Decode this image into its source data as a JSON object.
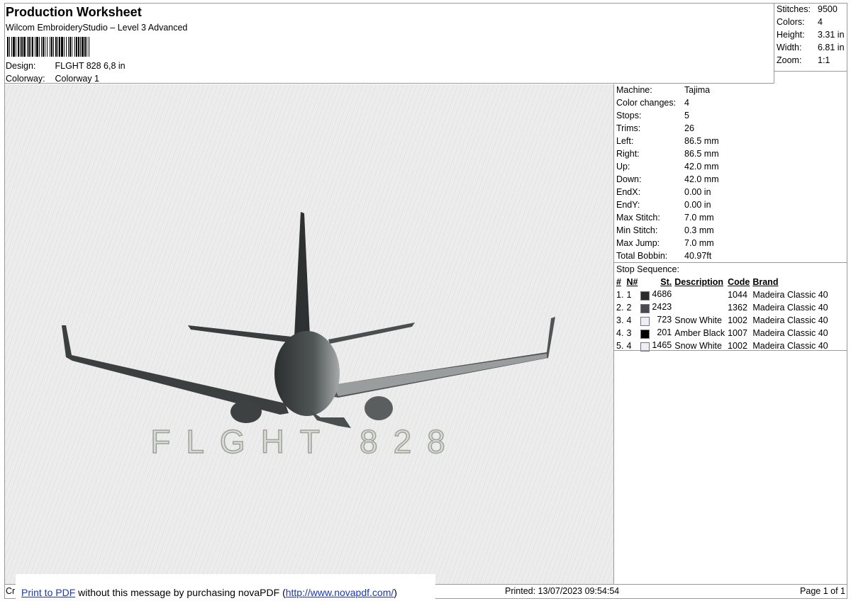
{
  "header": {
    "title": "Production Worksheet",
    "subtitle": "Wilcom EmbroideryStudio – Level 3 Advanced",
    "design_label": "Design:",
    "design_value": "FLGHT 828 6,8 in",
    "colorway_label": "Colorway:",
    "colorway_value": "Colorway 1"
  },
  "summary": [
    {
      "label": "Stitches:",
      "value": "9500"
    },
    {
      "label": "Colors:",
      "value": "4"
    },
    {
      "label": "Height:",
      "value": "3.31 in"
    },
    {
      "label": "Width:",
      "value": "6.81 in"
    },
    {
      "label": "Zoom:",
      "value": "1:1"
    }
  ],
  "machine_info": [
    {
      "label": "Machine:",
      "value": "Tajima"
    },
    {
      "label": "Color changes:",
      "value": "4"
    },
    {
      "label": "Stops:",
      "value": "5"
    },
    {
      "label": "Trims:",
      "value": "26"
    },
    {
      "label": "Left:",
      "value": "86.5 mm"
    },
    {
      "label": "Right:",
      "value": "86.5 mm"
    },
    {
      "label": "Up:",
      "value": "42.0 mm"
    },
    {
      "label": "Down:",
      "value": "42.0 mm"
    },
    {
      "label": "EndX:",
      "value": "0.00 in"
    },
    {
      "label": "EndY:",
      "value": "0.00 in"
    },
    {
      "label": "Max Stitch:",
      "value": "7.0 mm"
    },
    {
      "label": "Min Stitch:",
      "value": "0.3 mm"
    },
    {
      "label": "Max Jump:",
      "value": "7.0 mm"
    },
    {
      "label": "Total Bobbin:",
      "value": "40.97ft"
    }
  ],
  "stop_sequence": {
    "title": "Stop Sequence:",
    "columns": [
      "#",
      "N#",
      "St.",
      "Description",
      "Code",
      "Brand"
    ],
    "rows": [
      {
        "num": "1.",
        "n": "1",
        "color": "#2b2b2b",
        "st": "4686",
        "desc": "",
        "code": "1044",
        "brand": "Madeira Classic 40"
      },
      {
        "num": "2.",
        "n": "2",
        "color": "#4a4a52",
        "st": "2423",
        "desc": "",
        "code": "1362",
        "brand": "Madeira Classic 40"
      },
      {
        "num": "3.",
        "n": "4",
        "color": "#eeeef6",
        "st": "723",
        "desc": "Snow White",
        "code": "1002",
        "brand": "Madeira Classic 40"
      },
      {
        "num": "4.",
        "n": "3",
        "color": "#000000",
        "st": "201",
        "desc": "Amber Black",
        "code": "1007",
        "brand": "Madeira Classic 40"
      },
      {
        "num": "5.",
        "n": "4",
        "color": "#eeeef6",
        "st": "1465",
        "desc": "Snow White",
        "code": "1002",
        "brand": "Madeira Classic 40"
      }
    ]
  },
  "design_text": "FLGHT 828",
  "footer": {
    "cr": "Cr",
    "promo_link1": "Print to PDF",
    "promo_mid": " without this message by purchasing novaPDF (",
    "promo_link2": "http://www.novapdf.com/",
    "promo_end": ")",
    "printed": "Printed: 13/07/2023 09:54:54",
    "page": "Page 1 of 1"
  }
}
